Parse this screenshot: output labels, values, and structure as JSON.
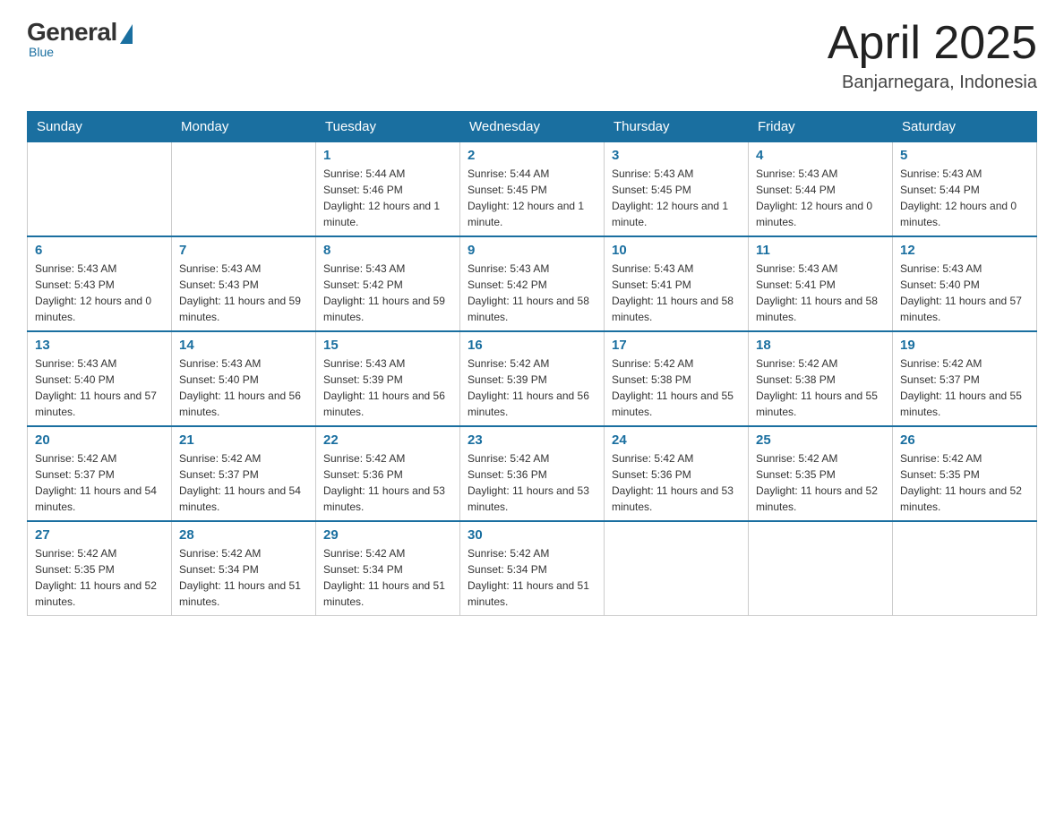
{
  "header": {
    "logo": {
      "general": "General",
      "blue": "Blue",
      "tagline": "Blue"
    },
    "title": "April 2025",
    "location": "Banjarnegara, Indonesia"
  },
  "calendar": {
    "days_of_week": [
      "Sunday",
      "Monday",
      "Tuesday",
      "Wednesday",
      "Thursday",
      "Friday",
      "Saturday"
    ],
    "weeks": [
      [
        {
          "day": "",
          "sunrise": "",
          "sunset": "",
          "daylight": ""
        },
        {
          "day": "",
          "sunrise": "",
          "sunset": "",
          "daylight": ""
        },
        {
          "day": "1",
          "sunrise": "Sunrise: 5:44 AM",
          "sunset": "Sunset: 5:46 PM",
          "daylight": "Daylight: 12 hours and 1 minute."
        },
        {
          "day": "2",
          "sunrise": "Sunrise: 5:44 AM",
          "sunset": "Sunset: 5:45 PM",
          "daylight": "Daylight: 12 hours and 1 minute."
        },
        {
          "day": "3",
          "sunrise": "Sunrise: 5:43 AM",
          "sunset": "Sunset: 5:45 PM",
          "daylight": "Daylight: 12 hours and 1 minute."
        },
        {
          "day": "4",
          "sunrise": "Sunrise: 5:43 AM",
          "sunset": "Sunset: 5:44 PM",
          "daylight": "Daylight: 12 hours and 0 minutes."
        },
        {
          "day": "5",
          "sunrise": "Sunrise: 5:43 AM",
          "sunset": "Sunset: 5:44 PM",
          "daylight": "Daylight: 12 hours and 0 minutes."
        }
      ],
      [
        {
          "day": "6",
          "sunrise": "Sunrise: 5:43 AM",
          "sunset": "Sunset: 5:43 PM",
          "daylight": "Daylight: 12 hours and 0 minutes."
        },
        {
          "day": "7",
          "sunrise": "Sunrise: 5:43 AM",
          "sunset": "Sunset: 5:43 PM",
          "daylight": "Daylight: 11 hours and 59 minutes."
        },
        {
          "day": "8",
          "sunrise": "Sunrise: 5:43 AM",
          "sunset": "Sunset: 5:42 PM",
          "daylight": "Daylight: 11 hours and 59 minutes."
        },
        {
          "day": "9",
          "sunrise": "Sunrise: 5:43 AM",
          "sunset": "Sunset: 5:42 PM",
          "daylight": "Daylight: 11 hours and 58 minutes."
        },
        {
          "day": "10",
          "sunrise": "Sunrise: 5:43 AM",
          "sunset": "Sunset: 5:41 PM",
          "daylight": "Daylight: 11 hours and 58 minutes."
        },
        {
          "day": "11",
          "sunrise": "Sunrise: 5:43 AM",
          "sunset": "Sunset: 5:41 PM",
          "daylight": "Daylight: 11 hours and 58 minutes."
        },
        {
          "day": "12",
          "sunrise": "Sunrise: 5:43 AM",
          "sunset": "Sunset: 5:40 PM",
          "daylight": "Daylight: 11 hours and 57 minutes."
        }
      ],
      [
        {
          "day": "13",
          "sunrise": "Sunrise: 5:43 AM",
          "sunset": "Sunset: 5:40 PM",
          "daylight": "Daylight: 11 hours and 57 minutes."
        },
        {
          "day": "14",
          "sunrise": "Sunrise: 5:43 AM",
          "sunset": "Sunset: 5:40 PM",
          "daylight": "Daylight: 11 hours and 56 minutes."
        },
        {
          "day": "15",
          "sunrise": "Sunrise: 5:43 AM",
          "sunset": "Sunset: 5:39 PM",
          "daylight": "Daylight: 11 hours and 56 minutes."
        },
        {
          "day": "16",
          "sunrise": "Sunrise: 5:42 AM",
          "sunset": "Sunset: 5:39 PM",
          "daylight": "Daylight: 11 hours and 56 minutes."
        },
        {
          "day": "17",
          "sunrise": "Sunrise: 5:42 AM",
          "sunset": "Sunset: 5:38 PM",
          "daylight": "Daylight: 11 hours and 55 minutes."
        },
        {
          "day": "18",
          "sunrise": "Sunrise: 5:42 AM",
          "sunset": "Sunset: 5:38 PM",
          "daylight": "Daylight: 11 hours and 55 minutes."
        },
        {
          "day": "19",
          "sunrise": "Sunrise: 5:42 AM",
          "sunset": "Sunset: 5:37 PM",
          "daylight": "Daylight: 11 hours and 55 minutes."
        }
      ],
      [
        {
          "day": "20",
          "sunrise": "Sunrise: 5:42 AM",
          "sunset": "Sunset: 5:37 PM",
          "daylight": "Daylight: 11 hours and 54 minutes."
        },
        {
          "day": "21",
          "sunrise": "Sunrise: 5:42 AM",
          "sunset": "Sunset: 5:37 PM",
          "daylight": "Daylight: 11 hours and 54 minutes."
        },
        {
          "day": "22",
          "sunrise": "Sunrise: 5:42 AM",
          "sunset": "Sunset: 5:36 PM",
          "daylight": "Daylight: 11 hours and 53 minutes."
        },
        {
          "day": "23",
          "sunrise": "Sunrise: 5:42 AM",
          "sunset": "Sunset: 5:36 PM",
          "daylight": "Daylight: 11 hours and 53 minutes."
        },
        {
          "day": "24",
          "sunrise": "Sunrise: 5:42 AM",
          "sunset": "Sunset: 5:36 PM",
          "daylight": "Daylight: 11 hours and 53 minutes."
        },
        {
          "day": "25",
          "sunrise": "Sunrise: 5:42 AM",
          "sunset": "Sunset: 5:35 PM",
          "daylight": "Daylight: 11 hours and 52 minutes."
        },
        {
          "day": "26",
          "sunrise": "Sunrise: 5:42 AM",
          "sunset": "Sunset: 5:35 PM",
          "daylight": "Daylight: 11 hours and 52 minutes."
        }
      ],
      [
        {
          "day": "27",
          "sunrise": "Sunrise: 5:42 AM",
          "sunset": "Sunset: 5:35 PM",
          "daylight": "Daylight: 11 hours and 52 minutes."
        },
        {
          "day": "28",
          "sunrise": "Sunrise: 5:42 AM",
          "sunset": "Sunset: 5:34 PM",
          "daylight": "Daylight: 11 hours and 51 minutes."
        },
        {
          "day": "29",
          "sunrise": "Sunrise: 5:42 AM",
          "sunset": "Sunset: 5:34 PM",
          "daylight": "Daylight: 11 hours and 51 minutes."
        },
        {
          "day": "30",
          "sunrise": "Sunrise: 5:42 AM",
          "sunset": "Sunset: 5:34 PM",
          "daylight": "Daylight: 11 hours and 51 minutes."
        },
        {
          "day": "",
          "sunrise": "",
          "sunset": "",
          "daylight": ""
        },
        {
          "day": "",
          "sunrise": "",
          "sunset": "",
          "daylight": ""
        },
        {
          "day": "",
          "sunrise": "",
          "sunset": "",
          "daylight": ""
        }
      ]
    ]
  }
}
